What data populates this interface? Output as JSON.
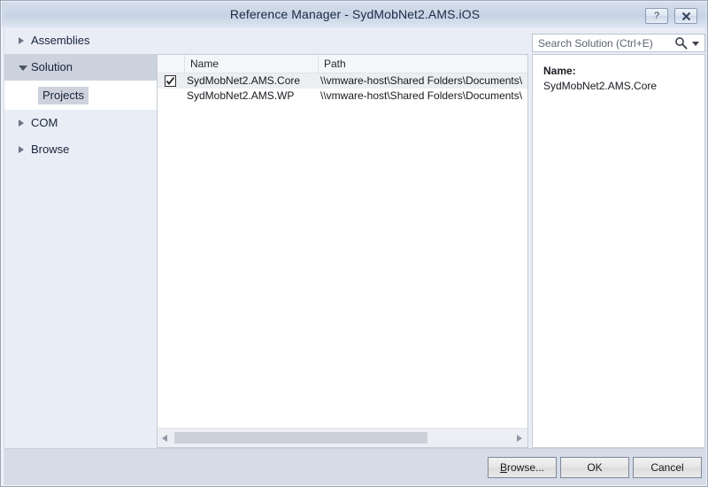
{
  "window": {
    "title": "Reference Manager - SydMobNet2.AMS.iOS",
    "help_button_label": "?",
    "close_button_label": "✕",
    "accent_color": "#ccd2de",
    "titlebar_color": "#cbd6e6",
    "footer_color": "#d6dbe8"
  },
  "sidebar": {
    "items": [
      {
        "label": "Assemblies",
        "state": "collapsed",
        "selected": false
      },
      {
        "label": "Solution",
        "state": "expanded",
        "selected": true
      },
      {
        "label": "COM",
        "state": "collapsed",
        "selected": false
      },
      {
        "label": "Browse",
        "state": "collapsed",
        "selected": false
      }
    ],
    "child": {
      "label": "Projects",
      "selected": true
    }
  },
  "search": {
    "placeholder": "Search Solution (Ctrl+E)",
    "value": "",
    "icon": "search-icon",
    "dropdown_icon": "chevron-down-icon"
  },
  "list": {
    "columns": [
      {
        "key": "check",
        "label": ""
      },
      {
        "key": "name",
        "label": "Name"
      },
      {
        "key": "path",
        "label": "Path"
      }
    ],
    "rows": [
      {
        "checked": true,
        "name": "SydMobNet2.AMS.Core",
        "path": "\\\\vmware-host\\Shared Folders\\Documents\\",
        "selected": true
      },
      {
        "checked": false,
        "name": "SydMobNet2.AMS.WP",
        "path": "\\\\vmware-host\\Shared Folders\\Documents\\",
        "selected": false
      }
    ],
    "scrollbar": {
      "left_arrow_icon": "arrow-left-icon",
      "right_arrow_icon": "arrow-right-icon"
    }
  },
  "detail": {
    "label": "Name:",
    "value": "SydMobNet2.AMS.Core"
  },
  "footer": {
    "browse_prefix": "B",
    "browse_rest": "rowse...",
    "ok_label": "OK",
    "cancel_label": "Cancel"
  }
}
